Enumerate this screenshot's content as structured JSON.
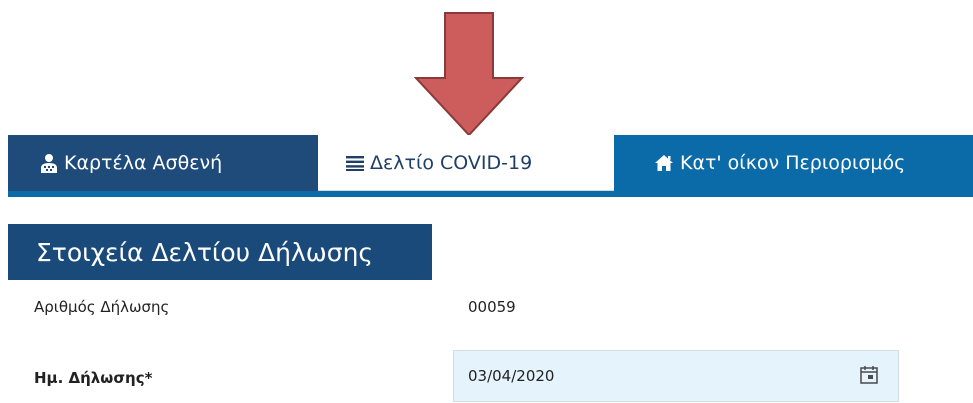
{
  "tabs": [
    {
      "label": "Καρτέλα Ασθενή",
      "icon": "user-icon",
      "active": false
    },
    {
      "label": "Δελτίο COVID-19",
      "icon": "list-icon",
      "active": true
    },
    {
      "label": "Κατ' οίκον Περιορισμός",
      "icon": "home-icon",
      "active": false
    }
  ],
  "section": {
    "title": "Στοιχεία Δελτίου Δήλωσης"
  },
  "fields": {
    "declaration_number": {
      "label": "Αριθμός Δήλωσης",
      "value": "00059"
    },
    "declaration_date": {
      "label": "Ημ. Δήλωσης*",
      "value": "03/04/2020"
    }
  },
  "colors": {
    "arrow_fill": "#cd5c5c",
    "arrow_stroke": "#8a3a3a",
    "tab_patient_bg": "#1e4b7a",
    "tab_home_bg": "#0b6aa8",
    "section_bg": "#1a4a7a",
    "date_field_bg": "#e5f3fc"
  }
}
